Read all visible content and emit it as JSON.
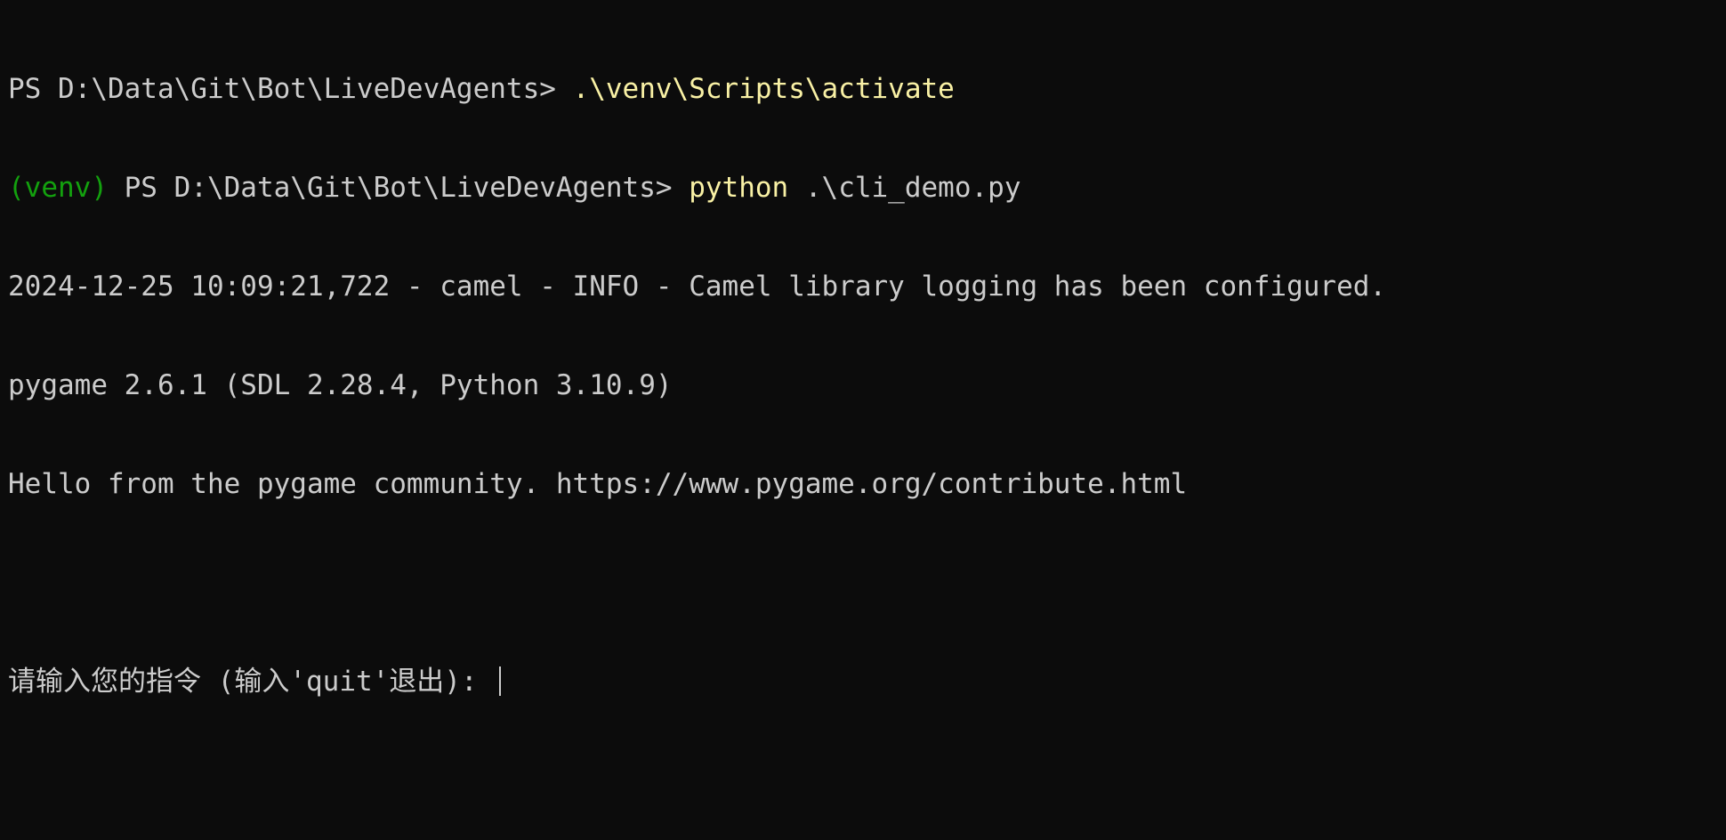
{
  "terminal": {
    "lines": [
      {
        "prompt": "PS D:\\Data\\Git\\Bot\\LiveDevAgents> ",
        "command": ".\\venv\\Scripts\\activate"
      },
      {
        "venv": "(venv)",
        "prompt": " PS D:\\Data\\Git\\Bot\\LiveDevAgents> ",
        "command": "python",
        "args": " .\\cli_demo.py"
      },
      {
        "text": "2024-12-25 10:09:21,722 - camel - INFO - Camel library logging has been configured."
      },
      {
        "text": "pygame 2.6.1 (SDL 2.28.4, Python 3.10.9)"
      },
      {
        "text": "Hello from the pygame community. https://www.pygame.org/contribute.html"
      },
      {
        "text": ""
      },
      {
        "input_prompt": "请输入您的指令 (输入'quit'退出): "
      }
    ]
  },
  "colors": {
    "background": "#0c0c0c",
    "foreground": "#cccccc",
    "command": "#f9f1a5",
    "venv": "#13a10e"
  }
}
